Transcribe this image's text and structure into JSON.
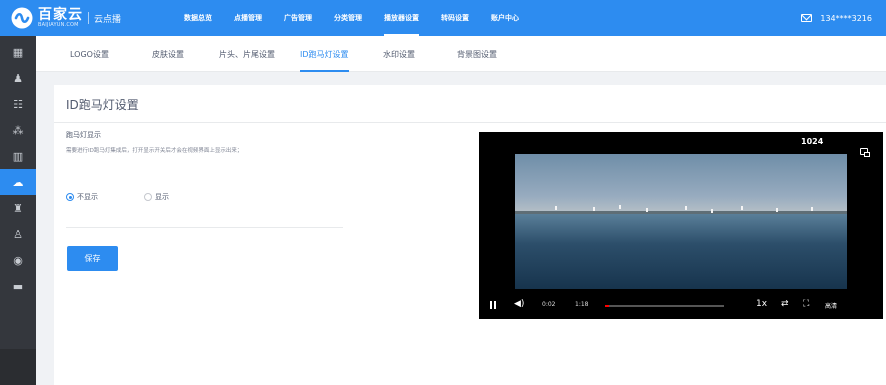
{
  "header": {
    "brand_name": "百家云",
    "brand_sub": "BAIJIAYUN.COM",
    "product": "云点播",
    "nav": [
      {
        "label": "数据总览"
      },
      {
        "label": "点播管理"
      },
      {
        "label": "广告管理"
      },
      {
        "label": "分类管理"
      },
      {
        "label": "播放器设置",
        "active": true
      },
      {
        "label": "转码设置"
      },
      {
        "label": "账户中心"
      }
    ],
    "phone": "134****3216",
    "accent": "#2d8cf0"
  },
  "sidebar": {
    "items": [
      {
        "icon": "grid-icon"
      },
      {
        "icon": "user-icon"
      },
      {
        "icon": "users-icon"
      },
      {
        "icon": "group-icon"
      },
      {
        "icon": "chart-icon"
      },
      {
        "icon": "cloud-upload-icon",
        "active": true
      },
      {
        "icon": "org-icon"
      },
      {
        "icon": "person-icon"
      },
      {
        "icon": "disc-icon"
      },
      {
        "icon": "folder-icon"
      }
    ]
  },
  "subtabs": [
    {
      "label": "LOGO设置"
    },
    {
      "label": "皮肤设置"
    },
    {
      "label": "片头、片尾设置"
    },
    {
      "label": "ID跑马灯设置",
      "active": true
    },
    {
      "label": "水印设置"
    },
    {
      "label": "背景图设置"
    }
  ],
  "main": {
    "title": "ID跑马灯设置",
    "field_label": "跑马灯显示",
    "field_desc": "需要进行ID跑马灯集成后，打开显示开关后才会在视频界面上显示出来；",
    "radio_options": [
      {
        "label": "不显示",
        "checked": true
      },
      {
        "label": "显示",
        "checked": false
      }
    ],
    "save_label": "保存"
  },
  "player": {
    "marquee_text": "1024",
    "time_current": "0:02",
    "time_total": "1:18",
    "progress_fraction": 0.03,
    "speed": "1x",
    "quality": "高清"
  }
}
